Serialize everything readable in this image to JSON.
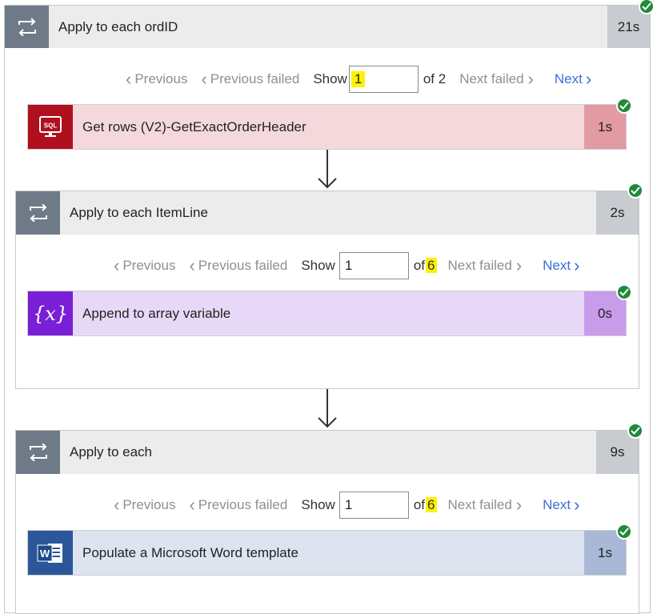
{
  "outer_loop": {
    "title": "Apply to each ordID",
    "duration": "21s",
    "pager": {
      "previous": "Previous",
      "previous_failed": "Previous failed",
      "show": "Show",
      "value": "1",
      "of": "of 2",
      "next_failed": "Next failed",
      "next": "Next"
    }
  },
  "sql_action": {
    "title": "Get rows (V2)-GetExactOrderHeader",
    "duration": "1s",
    "icon": "sql-icon",
    "icon_text": "SQL"
  },
  "itemline_loop": {
    "title": "Apply to each ItemLine",
    "duration": "2s",
    "pager": {
      "previous": "Previous",
      "previous_failed": "Previous failed",
      "show": "Show",
      "value": "1",
      "of_prefix": "of",
      "of_count": "6",
      "next_failed": "Next failed",
      "next": "Next"
    }
  },
  "append_action": {
    "title": "Append to array variable",
    "duration": "0s",
    "icon": "variable-icon",
    "icon_text": "{x}"
  },
  "each_loop": {
    "title": "Apply to each",
    "duration": "9s",
    "pager": {
      "previous": "Previous",
      "previous_failed": "Previous failed",
      "show": "Show",
      "value": "1",
      "of_prefix": "of",
      "of_count": "6",
      "next_failed": "Next failed",
      "next": "Next"
    }
  },
  "word_action": {
    "title": "Populate a Microsoft Word template",
    "duration": "1s",
    "icon": "word-icon",
    "icon_text": "W"
  },
  "colors": {
    "loop_icon_bg": "#6e7a88",
    "sql_bg": "#f5d8dc",
    "sql_icon": "#b0101e",
    "variable_bg": "#e8d8f8",
    "variable_icon": "#7a1fd6",
    "word_bg": "#dde4f0",
    "word_icon": "#2b579a",
    "success": "#1e8a3a",
    "link": "#3b6ed6",
    "highlight": "#fff200"
  }
}
